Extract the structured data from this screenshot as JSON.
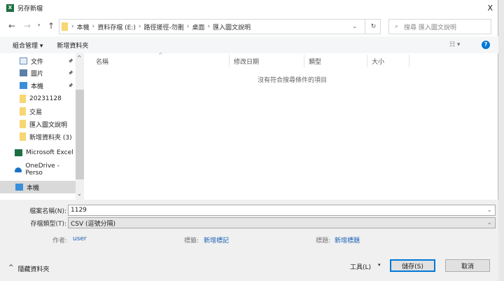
{
  "window": {
    "title": "另存新檔",
    "close": "X"
  },
  "address": {
    "crumbs": [
      "本機",
      "資料存檔 (E:)",
      "路徑搓徑-勿刪",
      "桌面",
      "匯入圖文說明"
    ]
  },
  "search": {
    "placeholder": "搜尋 匯入圖文說明"
  },
  "toolbar": {
    "organize": "組合管理 ▾",
    "new_folder": "新增資料夾",
    "help": "?"
  },
  "nav": {
    "items": [
      {
        "label": "文件",
        "icon": "document-icon",
        "pinned": true
      },
      {
        "label": "圖片",
        "icon": "pictures-icon",
        "pinned": true
      },
      {
        "label": "本機",
        "icon": "computer-icon",
        "pinned": true
      },
      {
        "label": "20231128",
        "icon": "folder-icon"
      },
      {
        "label": "交易",
        "icon": "folder-icon"
      },
      {
        "label": "匯入圖文說明",
        "icon": "folder-icon"
      },
      {
        "label": "新增資料夾 (3)",
        "icon": "folder-icon"
      },
      {
        "label": "Microsoft Excel",
        "icon": "excel-icon"
      },
      {
        "label": "OneDrive - Perso",
        "icon": "onedrive-icon"
      },
      {
        "label": "本機",
        "icon": "computer-icon",
        "selected": true
      }
    ]
  },
  "columns": [
    "名稱",
    "修改日期",
    "類型",
    "大小"
  ],
  "empty_message": "沒有符合搜尋條件的項目",
  "form": {
    "filename_label": "檔案名稱(N):",
    "filename": "1129",
    "type_label": "存檔類型(T):",
    "type": "CSV (逗號分隔)",
    "author_label": "作者:",
    "author": "user",
    "tags_label": "標籤:",
    "tags": "新增標記",
    "title_label": "標題:",
    "title": "新增標題"
  },
  "footer": {
    "hide_folders": "隱藏資料夾",
    "tools": "工具(L)",
    "save": "儲存(S)",
    "cancel": "取消"
  },
  "colors": {
    "accent": "#0078d7",
    "excel": "#1d6f42",
    "folder": "#f7d774"
  }
}
